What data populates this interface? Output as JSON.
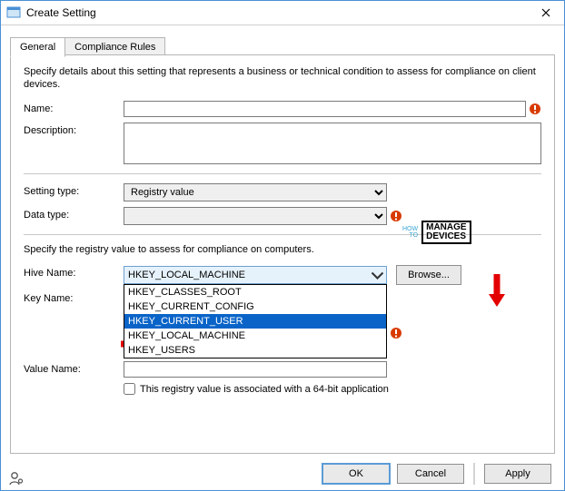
{
  "window": {
    "title": "Create Setting"
  },
  "tabs": {
    "general": "General",
    "compliance": "Compliance Rules",
    "active": "general"
  },
  "intro": "Specify details about this setting that represents a business or technical condition to assess for compliance on client devices.",
  "labels": {
    "name": "Name:",
    "description": "Description:",
    "setting_type": "Setting type:",
    "data_type": "Data type:",
    "hive": "Hive Name:",
    "key": "Key Name:",
    "value": "Value Name:"
  },
  "fields": {
    "name": "",
    "description": "",
    "setting_type": "Registry value",
    "data_type": "",
    "key": "",
    "value": ""
  },
  "registry_intro": "Specify the registry value to assess for compliance on computers.",
  "hive": {
    "selected": "HKEY_LOCAL_MACHINE",
    "highlighted": "HKEY_CURRENT_USER",
    "options": [
      "HKEY_CLASSES_ROOT",
      "HKEY_CURRENT_CONFIG",
      "HKEY_CURRENT_USER",
      "HKEY_LOCAL_MACHINE",
      "HKEY_USERS"
    ]
  },
  "browse_label": "Browse...",
  "checkbox_label": "This registry value is associated with a 64-bit application",
  "checkbox_checked": false,
  "buttons": {
    "ok": "OK",
    "cancel": "Cancel",
    "apply": "Apply"
  },
  "watermark": {
    "small1": "HOW",
    "small2": "TO",
    "big1": "MANAGE",
    "big2": "DEVICES"
  }
}
